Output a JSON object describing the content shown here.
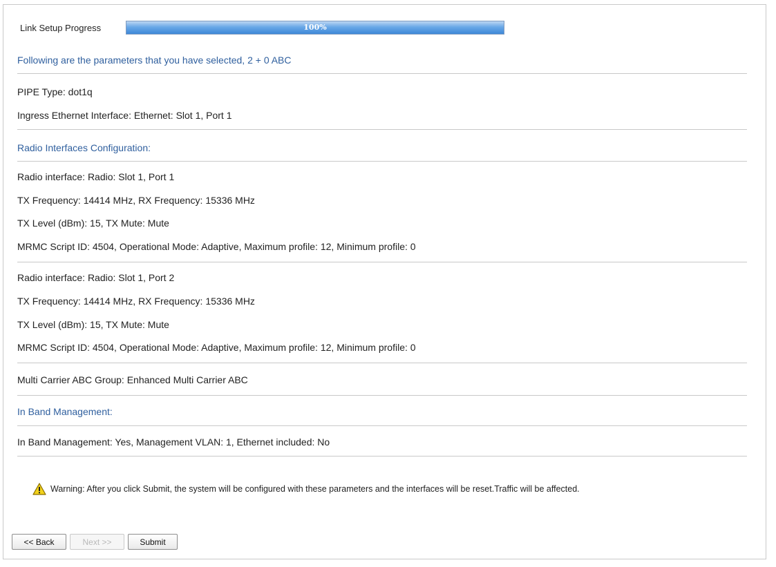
{
  "progress": {
    "label": "Link Setup Progress",
    "value_text": "100%",
    "fraction": 1.0
  },
  "summary_heading": "Following are the parameters that you have selected, 2 + 0 ABC",
  "pipe_type": "PIPE Type: dot1q",
  "ingress": "Ingress Ethernet Interface: Ethernet: Slot 1, Port 1",
  "radio_heading": "Radio Interfaces Configuration:",
  "radios": [
    {
      "interface": "Radio interface: Radio: Slot 1, Port 1",
      "frequency": "TX Frequency: 14414 MHz, RX Frequency: 15336 MHz",
      "level": "TX Level (dBm): 15, TX Mute: Mute",
      "mrmc": "MRMC Script ID: 4504, Operational Mode: Adaptive, Maximum profile: 12, Minimum profile: 0"
    },
    {
      "interface": "Radio interface: Radio: Slot 1, Port 2",
      "frequency": "TX Frequency: 14414 MHz, RX Frequency: 15336 MHz",
      "level": "TX Level (dBm): 15, TX Mute: Mute",
      "mrmc": "MRMC Script ID: 4504, Operational Mode: Adaptive, Maximum profile: 12, Minimum profile: 0"
    }
  ],
  "multi_carrier": "Multi Carrier ABC Group: Enhanced Multi Carrier ABC",
  "inband_heading": "In Band Management:",
  "inband": "In Band Management: Yes, Management VLAN: 1, Ethernet included: No",
  "warning": {
    "icon": "warning-triangle-icon",
    "text": "Warning: After you click Submit, the system will be configured with these parameters and the interfaces will be reset.Traffic will be affected."
  },
  "buttons": {
    "back": "<< Back",
    "next": "Next >>",
    "submit": "Submit"
  },
  "colors": {
    "heading_blue": "#2f5f9e",
    "progress_blue": "#3e88d8",
    "warning_yellow": "#f2d21b"
  }
}
